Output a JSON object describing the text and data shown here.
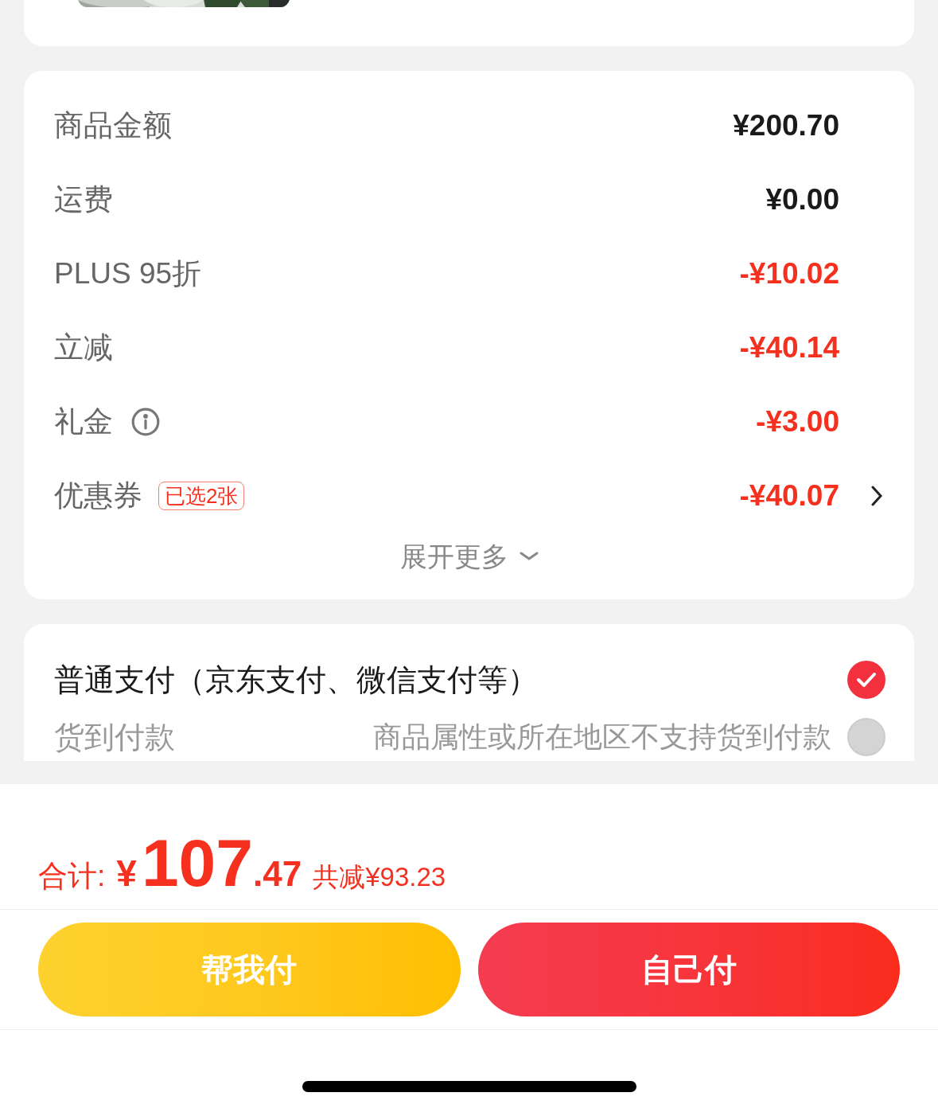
{
  "summary": {
    "rows": [
      {
        "kind": "plain",
        "label": "商品金额",
        "value": "¥200.70",
        "discount": false
      },
      {
        "kind": "plain",
        "label": "运费",
        "value": "¥0.00",
        "discount": false
      },
      {
        "kind": "plain",
        "label": "PLUS 95折",
        "value": "-¥10.02",
        "discount": true
      },
      {
        "kind": "plain",
        "label": "立减",
        "value": "-¥40.14",
        "discount": true
      },
      {
        "kind": "info",
        "label": "礼金",
        "value": "-¥3.00",
        "discount": true
      },
      {
        "kind": "coupon",
        "label": "优惠券",
        "badge": "已选2张",
        "value": "-¥40.07",
        "discount": true
      }
    ],
    "expand": "展开更多"
  },
  "payment": {
    "options": [
      {
        "label": "普通支付（京东支付、微信支付等）",
        "selected": true,
        "disabled": false
      },
      {
        "label": "货到付款",
        "note": "商品属性或所在地区不支持货到付款",
        "selected": false,
        "disabled": true
      }
    ]
  },
  "total": {
    "label": "合计:",
    "currency": "¥",
    "integer": "107",
    "decimal": ".47",
    "saving": "共减¥93.23"
  },
  "buttons": [
    {
      "kind": "secondary",
      "label": "帮我付"
    },
    {
      "kind": "primary",
      "label": "自己付"
    }
  ]
}
